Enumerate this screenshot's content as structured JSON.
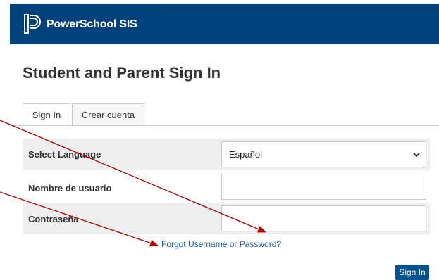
{
  "header": {
    "brand": "PowerSchool SIS",
    "background": "#00427c"
  },
  "page_title": "Student and Parent Sign In",
  "tabs": [
    {
      "label": "Sign In",
      "active": true
    },
    {
      "label": "Crear cuenta",
      "active": false
    }
  ],
  "form": {
    "language_label": "Select Language",
    "language_value": "Español",
    "username_label": "Nombre de usuario",
    "username_value": "",
    "password_label": "Contraseña",
    "password_value": ""
  },
  "forgot_link": "Forgot Username or Password?",
  "sign_in_button": "Sign In",
  "icons": {
    "logo": "powerschool-logo-icon",
    "dropdown": "chevron-down-icon"
  },
  "annotation_color": "#b30000"
}
